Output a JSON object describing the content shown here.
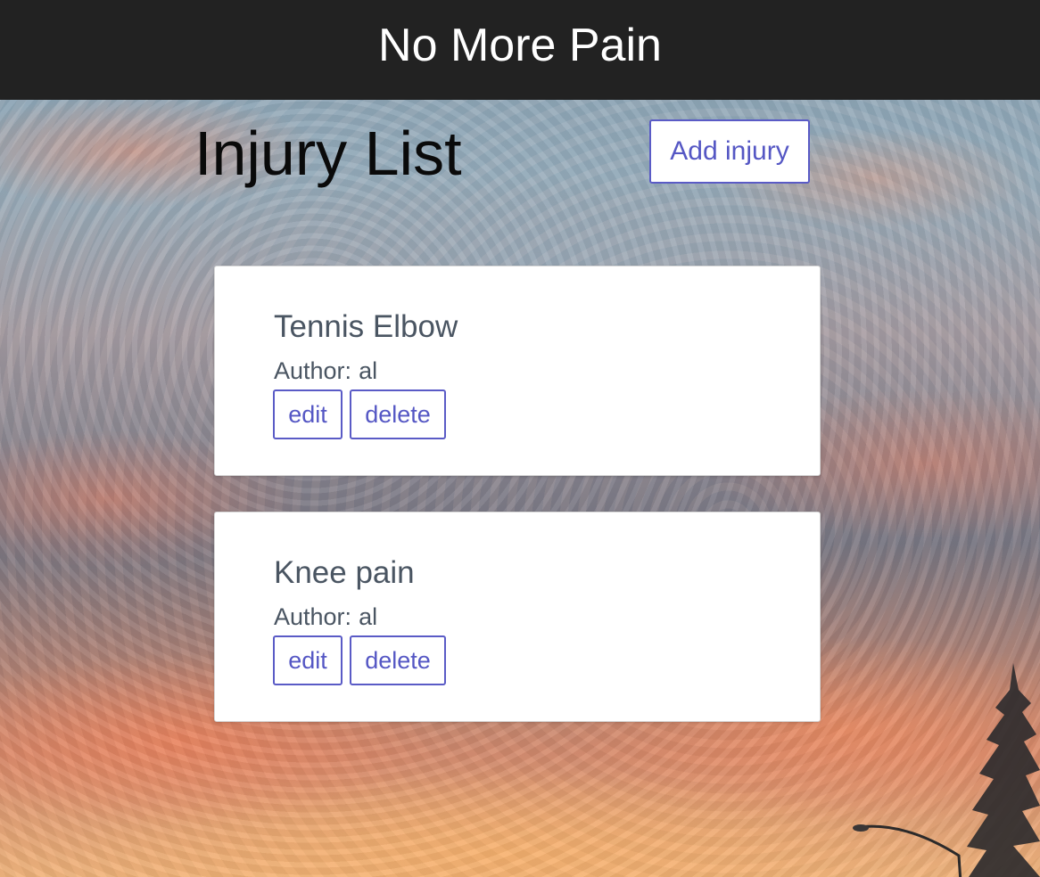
{
  "header": {
    "title": "No More Pain"
  },
  "main": {
    "heading": "Injury List",
    "add_button_label": "Add injury",
    "author_label": "Author:",
    "edit_label": "edit",
    "delete_label": "delete",
    "injuries": [
      {
        "title": "Tennis Elbow",
        "author": "al"
      },
      {
        "title": "Knee pain",
        "author": "al"
      }
    ]
  },
  "colors": {
    "topbar_background": "#222222",
    "accent": "#5557c4",
    "card_text": "#4a5562"
  }
}
